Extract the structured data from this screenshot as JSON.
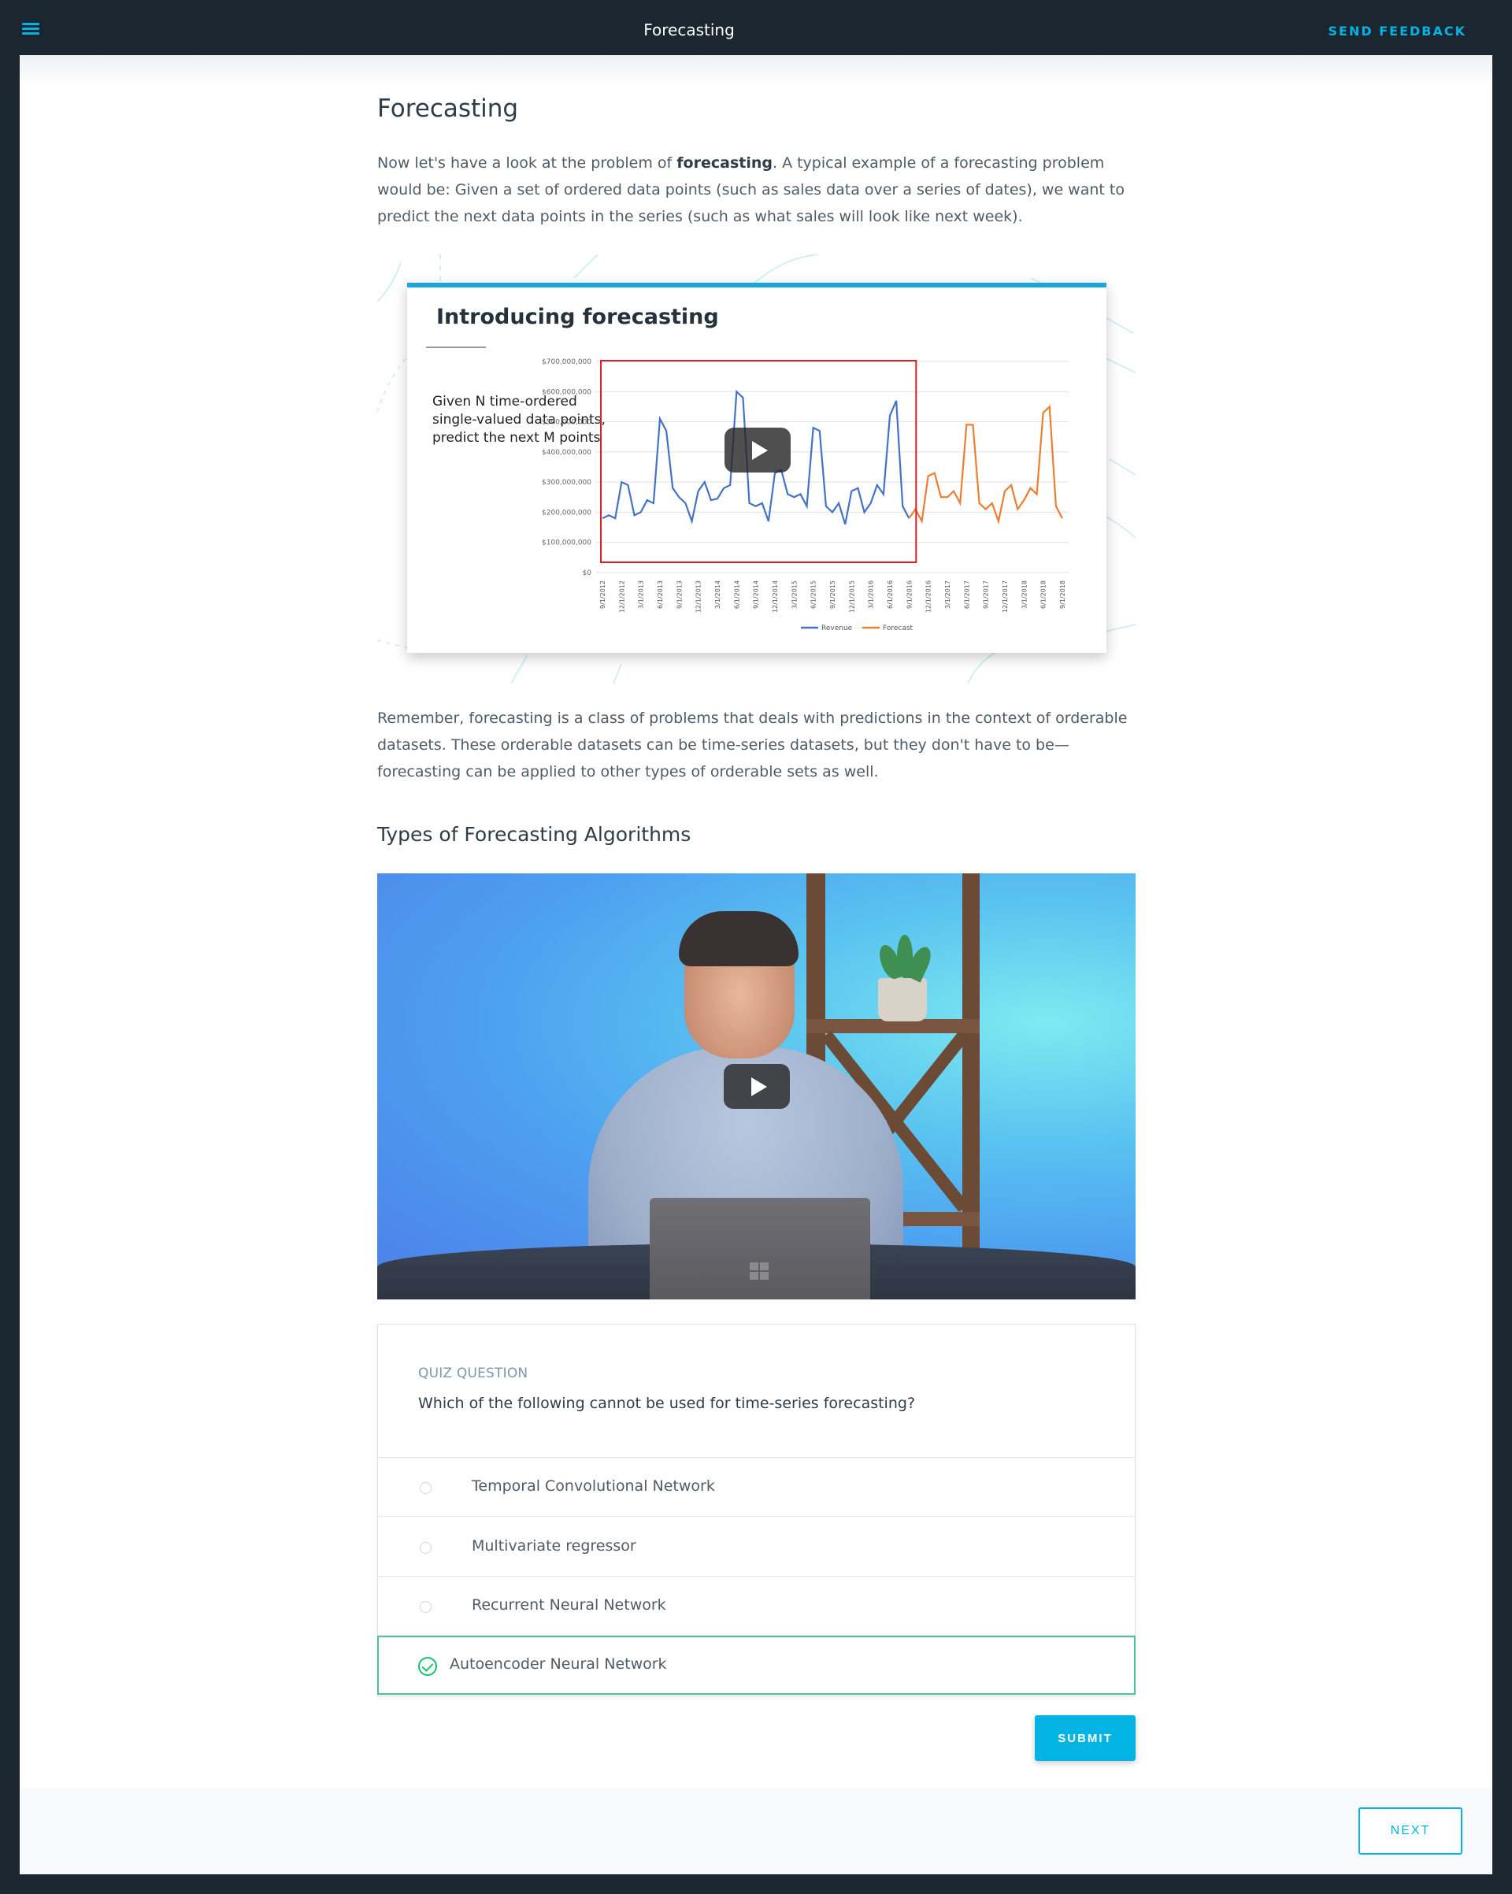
{
  "topbar": {
    "title": "Forecasting",
    "feedback_label": "SEND FEEDBACK",
    "menu_icon": "hamburger-menu-icon"
  },
  "page": {
    "heading": "Forecasting",
    "intro_before": "Now let's have a look at the problem of ",
    "intro_bold": "forecasting",
    "intro_after": ". A typical example of a forecasting problem would be: Given a set of ordered data points (such as sales data over a series of dates), we want to predict the next data points in the series (such as what sales will look like next week).",
    "remember": "Remember, forecasting is a class of problems that deals with predictions in the context of orderable datasets. These orderable datasets can be time-series datasets, but they don't have to be—forecasting can be applied to other types of orderable sets as well.",
    "section_heading": "Types of Forecasting Algorithms"
  },
  "slide": {
    "title": "Introducing forecasting",
    "text": "Given N time-ordered single-valued data points, predict the next M points"
  },
  "chart_data": {
    "type": "line",
    "ylim": [
      0,
      700000000
    ],
    "y_ticks": [
      "$700,000,000",
      "$600,000,000",
      "$500,000,000",
      "$400,000,000",
      "$300,000,000",
      "$200,000,000",
      "$100,000,000",
      "$0"
    ],
    "x_ticks": [
      "9/1/2012",
      "12/1/2012",
      "3/1/2013",
      "6/1/2013",
      "9/1/2013",
      "12/1/2013",
      "3/1/2014",
      "6/1/2014",
      "9/1/2014",
      "12/1/2014",
      "3/1/2015",
      "6/1/2015",
      "9/1/2015",
      "12/1/2015",
      "3/1/2016",
      "6/1/2016",
      "9/1/2016",
      "12/1/2016",
      "3/1/2017",
      "6/1/2017",
      "9/1/2017",
      "12/1/2017",
      "3/1/2018",
      "6/1/2018",
      "9/1/2018"
    ],
    "legend": "bottom",
    "series": [
      {
        "name": "Revenue",
        "color": "#4472c4",
        "values": [
          180000000,
          190000000,
          180000000,
          300000000,
          290000000,
          190000000,
          200000000,
          240000000,
          230000000,
          510000000,
          470000000,
          280000000,
          250000000,
          230000000,
          170000000,
          270000000,
          300000000,
          240000000,
          245000000,
          280000000,
          290000000,
          600000000,
          580000000,
          230000000,
          220000000,
          230000000,
          170000000,
          330000000,
          340000000,
          260000000,
          250000000,
          260000000,
          220000000,
          480000000,
          470000000,
          220000000,
          200000000,
          230000000,
          160000000,
          270000000,
          280000000,
          200000000,
          230000000,
          290000000,
          260000000,
          520000000,
          570000000,
          220000000,
          180000000
        ]
      },
      {
        "name": "Forecast",
        "color": "#ed7d31",
        "values": [
          210000000,
          170000000,
          320000000,
          330000000,
          250000000,
          250000000,
          270000000,
          230000000,
          490000000,
          490000000,
          230000000,
          210000000,
          230000000,
          170000000,
          270000000,
          290000000,
          210000000,
          240000000,
          280000000,
          260000000,
          530000000,
          550000000,
          220000000,
          180000000
        ]
      }
    ]
  },
  "quiz": {
    "label": "QUIZ QUESTION",
    "question": "Which of the following cannot be used for time-series forecasting?",
    "options": [
      {
        "label": "Temporal Convolutional Network",
        "selected": false
      },
      {
        "label": "Multivariate regressor",
        "selected": false
      },
      {
        "label": "Recurrent Neural Network",
        "selected": false
      },
      {
        "label": "Autoencoder Neural Network",
        "selected": true
      }
    ],
    "submit_label": "SUBMIT"
  },
  "footer": {
    "next_label": "NEXT"
  },
  "colors": {
    "accent": "#02b3e4",
    "topbar": "#1c2630",
    "correct": "#15c26b"
  }
}
